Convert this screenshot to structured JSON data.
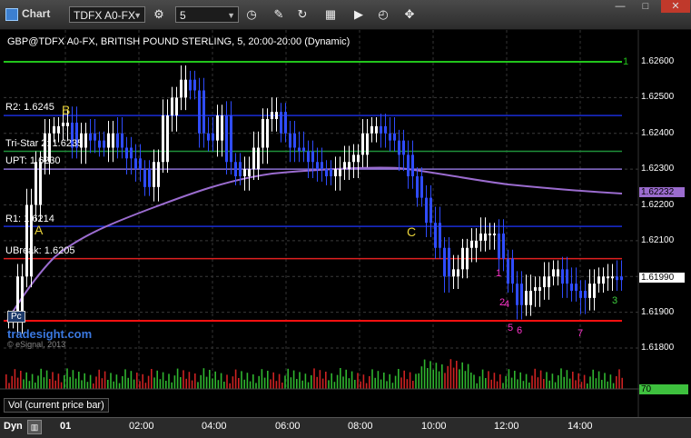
{
  "window": {
    "title": "Chart",
    "min": "—",
    "max": "□",
    "close": "✕"
  },
  "toolbar": {
    "symbol": "TDFX A0-FX",
    "interval": "5",
    "icons": [
      "gear-icon",
      "clock-icon",
      "pencil-icon",
      "indicator-icon",
      "grid-icon",
      "play-icon",
      "crosshair-icon"
    ]
  },
  "chart": {
    "header": "GBP@TDFX A0-FX, BRITISH POUND STERLING, 5, 20:00-20:00 (Dynamic)",
    "watermark_site": "tradesight.com",
    "watermark_copy": "© eSignal, 2013",
    "pc_label": "Pc",
    "price_axis": [
      "1.62600",
      "1.62500",
      "1.62400",
      "1.62300",
      "1.62200",
      "1.62100",
      "1.61900",
      "1.61800"
    ],
    "price_current": "1.61990",
    "price_ma": "1.62232",
    "level_flag": "1",
    "vol_value": "70",
    "levels": [
      {
        "label": "R2: 1.6245",
        "price": 1.6245,
        "color": "#1a2dd6"
      },
      {
        "label": "Tri-Star 2: 1.6235",
        "price": 1.6235,
        "color": "#1e8f3a"
      },
      {
        "label": "UPT: 1.6230",
        "price": 1.623,
        "color": "#8a6fd1"
      },
      {
        "label": "R1: 1.6214",
        "price": 1.6214,
        "color": "#1a2dd6"
      },
      {
        "label": "UBreak: 1.6205",
        "price": 1.6205,
        "color": "#e02020"
      }
    ],
    "wave_labels": [
      "A",
      "B",
      "C"
    ],
    "count_labels": [
      "1",
      "2",
      "3",
      "4",
      "5",
      "6",
      "7"
    ]
  },
  "vol_label": "Vol (current price bar)",
  "time_axis": [
    "01",
    "02:00",
    "04:00",
    "06:00",
    "08:00",
    "10:00",
    "12:00",
    "14:00"
  ],
  "dyn": "Dyn"
}
